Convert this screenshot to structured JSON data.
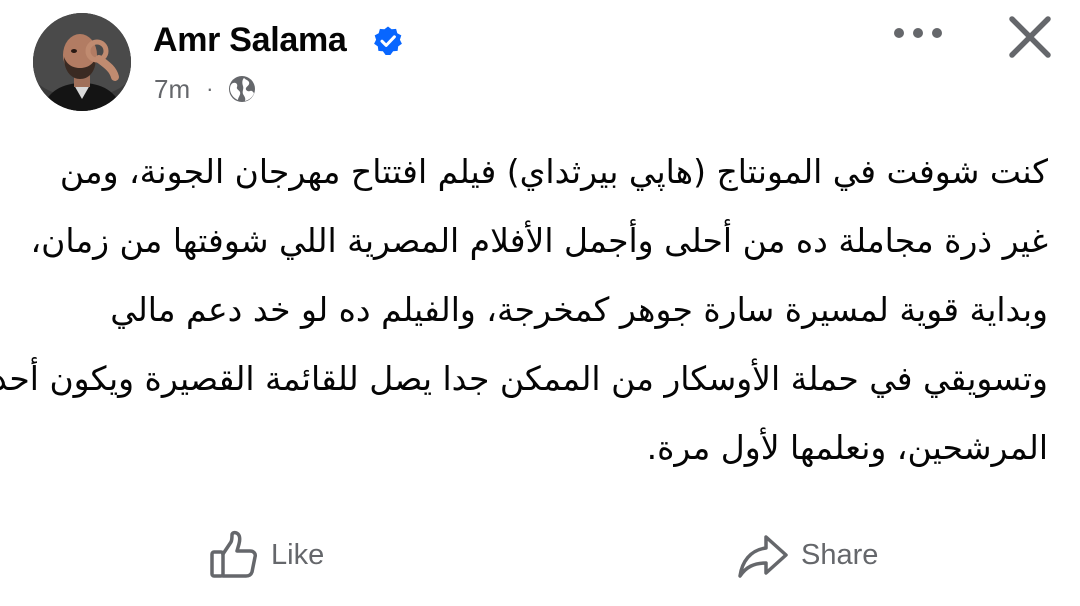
{
  "post": {
    "author": {
      "name": "Amr Salama",
      "verified": true,
      "avatar_icon": "profile-photo"
    },
    "timestamp": "7m",
    "separator": "·",
    "audience_icon": "globe-icon",
    "menu_icon": "more-horizontal-icon",
    "close_icon": "close-icon",
    "text_lines": [
      "كنت شوفت في المونتاج (هاپي بيرثداي) فيلم افتتاح مهرجان الجونة، ومن",
      "غير ذرة مجاملة ده من أحلى وأجمل الأفلام المصرية اللي شوفتها من زمان،",
      "وبداية قوية لمسيرة سارة جوهر كمخرجة، والفيلم ده لو خد دعم مالي",
      "وتسويقي في حملة الأوسكار من الممكن جدا يصل للقائمة القصيرة ويكون أحد",
      "المرشحين، ونعلمها لأول مرة."
    ]
  },
  "actions": {
    "like_label": "Like",
    "like_icon": "thumbs-up-icon",
    "share_label": "Share",
    "share_icon": "share-arrow-icon"
  },
  "colors": {
    "text_primary": "#050505",
    "text_secondary": "#65676b",
    "verified_blue": "#0866ff",
    "icon_gray": "#65676b"
  }
}
